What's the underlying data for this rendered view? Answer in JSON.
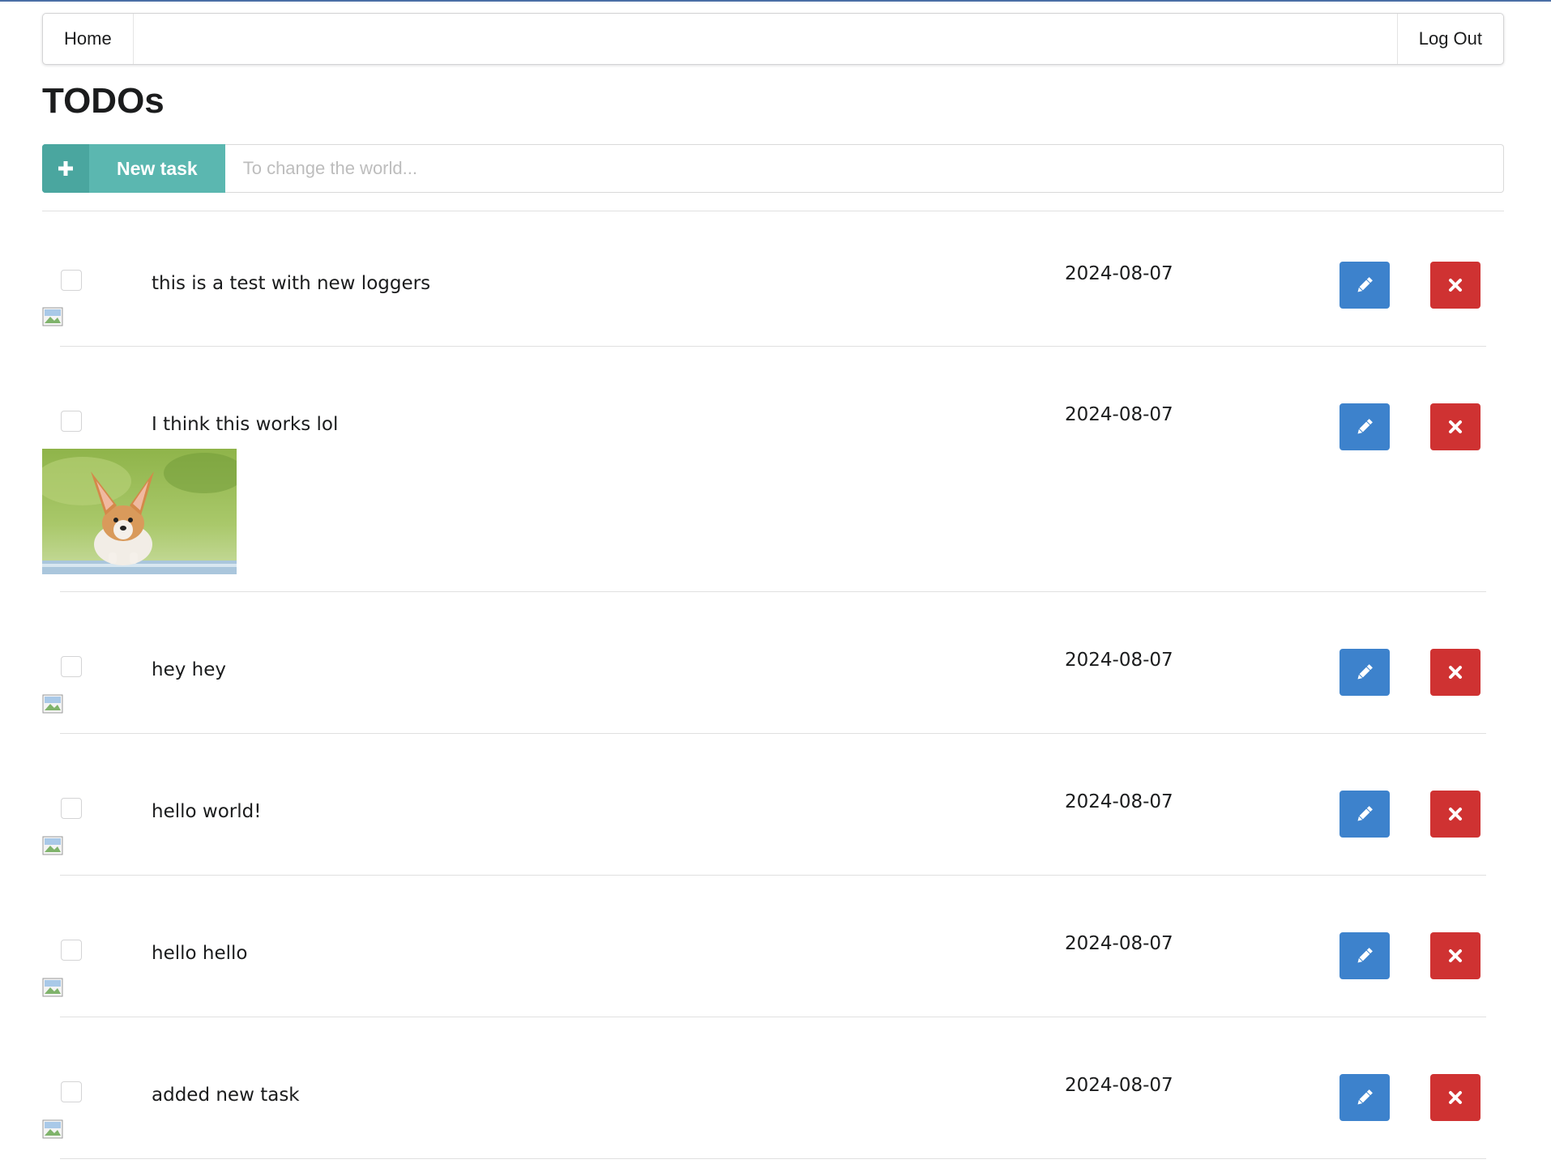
{
  "nav": {
    "home": "Home",
    "logout": "Log Out"
  },
  "page": {
    "title": "TODOs"
  },
  "new_task": {
    "button_label": "New task",
    "placeholder": "To change the world..."
  },
  "tasks": [
    {
      "text": "this is a test with new loggers",
      "date": "2024-08-07",
      "completed": false,
      "image": "broken"
    },
    {
      "text": "I think this works lol",
      "date": "2024-08-07",
      "completed": false,
      "image": "corgi-puppy-photo"
    },
    {
      "text": "hey hey",
      "date": "2024-08-07",
      "completed": false,
      "image": "broken"
    },
    {
      "text": "hello world!",
      "date": "2024-08-07",
      "completed": false,
      "image": "broken"
    },
    {
      "text": "hello hello",
      "date": "2024-08-07",
      "completed": false,
      "image": "broken"
    },
    {
      "text": "added new task",
      "date": "2024-08-07",
      "completed": false,
      "image": "broken"
    }
  ],
  "icons": {
    "add": "plus-icon",
    "edit": "pencil-icon",
    "delete": "x-icon",
    "broken_image": "broken-image-icon"
  },
  "colors": {
    "teal": "#5bb7b0",
    "teal_dark": "#4aa69f",
    "edit_blue": "#3d82cc",
    "delete_red": "#cf3232",
    "top_border": "#4a6fa5"
  }
}
